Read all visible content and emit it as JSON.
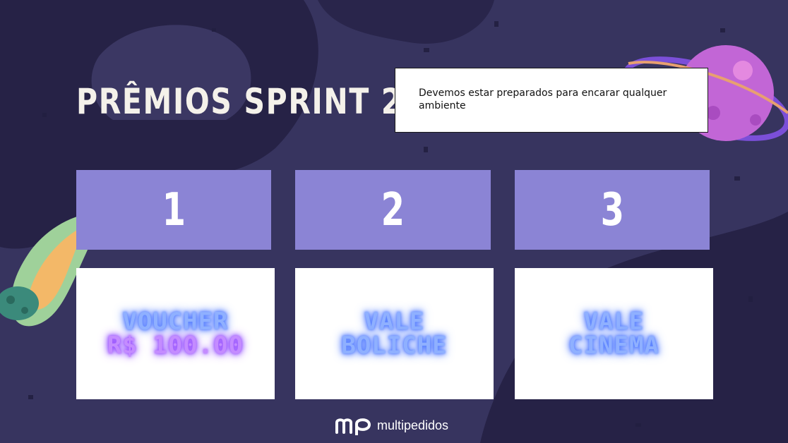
{
  "slide": {
    "title": "PRÊMIOS SPRINT 2",
    "note": "Devemos estar preparados para encarar qualquer ambiente"
  },
  "prizes": [
    {
      "rank": "1",
      "line1": "VOUCHER",
      "line2": "R$ 100.00"
    },
    {
      "rank": "2",
      "line1": "VALE",
      "line2": "BOLICHE"
    },
    {
      "rank": "3",
      "line1": "VALE",
      "line2": "CINEMA"
    }
  ],
  "logo": {
    "text": "multipedidos"
  },
  "colors": {
    "background": "#2d2a52",
    "rank_box": "#8b84d5",
    "neon_blue": "#8fb0ff",
    "neon_purple": "#c48cff",
    "title": "#f4f1ea"
  },
  "icons": [
    "planet-icon",
    "comet-icon",
    "multipedidos-logo-icon"
  ]
}
